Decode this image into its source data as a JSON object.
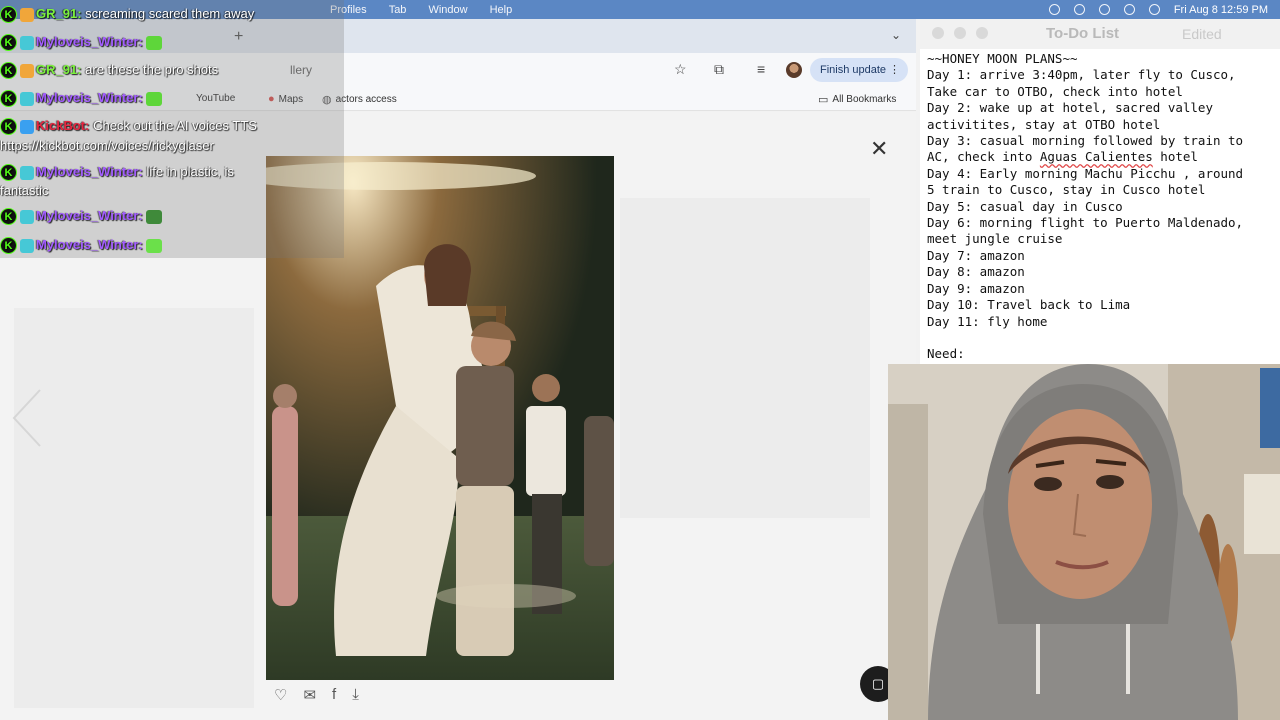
{
  "menubar": {
    "menus": [
      "Profiles",
      "Tab",
      "Window",
      "Help"
    ],
    "clock": "Fri Aug 8  12:59 PM"
  },
  "browser": {
    "url_fragment": "llery",
    "finish_update_label": "Finish update",
    "bookmarks": [
      {
        "label": "YouTube",
        "icon": "youtube-icon"
      },
      {
        "label": "Maps",
        "icon": "maps-pin-icon"
      },
      {
        "label": "actors access",
        "icon": "globe-icon"
      }
    ],
    "all_bookmarks_label": "All Bookmarks"
  },
  "chat": {
    "messages": [
      {
        "user": "GR_91:",
        "text": "screaming scared them away",
        "user_color": "#7cf23e"
      },
      {
        "user": "Myloveis_Winter:",
        "text": "",
        "user_color": "#a35dff",
        "emote": "frog-emote"
      },
      {
        "user": "GR_91:",
        "text": "are these the pro shots",
        "user_color": "#7cf23e"
      },
      {
        "user": "Myloveis_Winter:",
        "text": "",
        "user_color": "#a35dff",
        "emote": "frog-emote"
      },
      {
        "user": "KickBot:",
        "text": "Check out the AI voices TTS",
        "user_color": "#e8243f"
      },
      {
        "user": "",
        "text": "https://kickbot.com/voices/rickyglaser",
        "user_color": ""
      },
      {
        "user": "Myloveis_Winter:",
        "text": "life in plastic, is",
        "user_color": "#a35dff"
      },
      {
        "user": "",
        "text": "fantastic",
        "user_color": ""
      },
      {
        "user": "Myloveis_Winter:",
        "text": "",
        "user_color": "#a35dff",
        "emote": "cap-emote"
      },
      {
        "user": "Myloveis_Winter:",
        "text": "",
        "user_color": "#a35dff",
        "emote": "smile-emote"
      }
    ]
  },
  "todo": {
    "title": "To-Do List",
    "status": "Edited",
    "lines": [
      "~~HONEY MOON PLANS~~",
      "Day 1: arrive 3:40pm, later fly to Cusco,",
      "Take car to OTBO, check into hotel",
      "Day 2: wake up at hotel, sacred valley",
      "activitites, stay at OTBO hotel",
      "Day 3: casual morning followed by train to",
      "AC, check into Aguas Calientes hotel",
      "Day 4: Early morning Machu Picchu , around",
      "5 train to Cusco, stay in Cusco hotel",
      "Day 5: casual day in Cusco",
      "Day 6: morning flight to Puerto Maldenado,",
      "meet jungle cruise",
      "Day 7: amazon",
      "Day 8: amazon",
      "Day 9: amazon",
      "Day 10: Travel back to Lima",
      "Day 11: fly home",
      "",
      "Need:"
    ]
  },
  "photo_actions": [
    "heart-icon",
    "mail-icon",
    "facebook-icon",
    "download-icon"
  ]
}
